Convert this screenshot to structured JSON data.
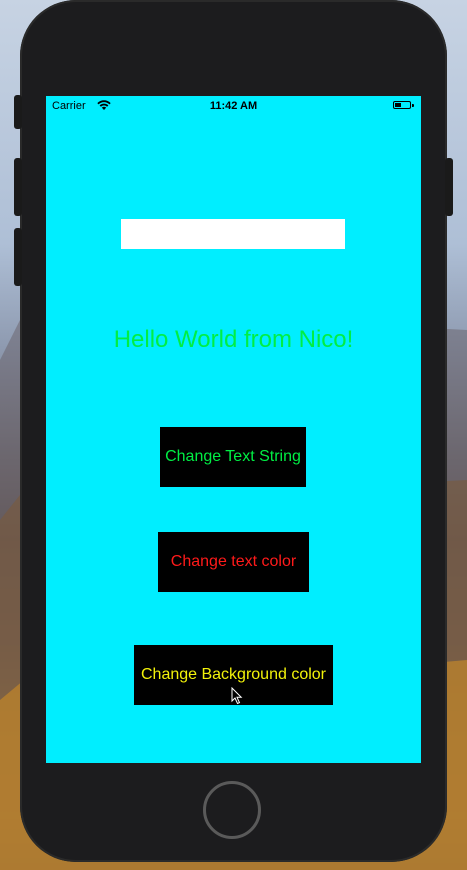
{
  "status_bar": {
    "carrier": "Carrier",
    "time": "11:42 AM",
    "battery_level": 0.45
  },
  "text_field": {
    "value": "",
    "placeholder": ""
  },
  "label": {
    "text": "Hello World from Nico!",
    "color": "#00ee44"
  },
  "buttons": {
    "change_text_string": {
      "label": "Change Text String",
      "color": "#00ee44"
    },
    "change_text_color": {
      "label": "Change text color",
      "color": "#ff1a1a"
    },
    "change_background_color": {
      "label": "Change Background color",
      "color": "#f2f20a"
    }
  },
  "colors": {
    "screen_background": "#00eeff",
    "button_background": "#000000",
    "device_frame": "#1c1c1e"
  }
}
